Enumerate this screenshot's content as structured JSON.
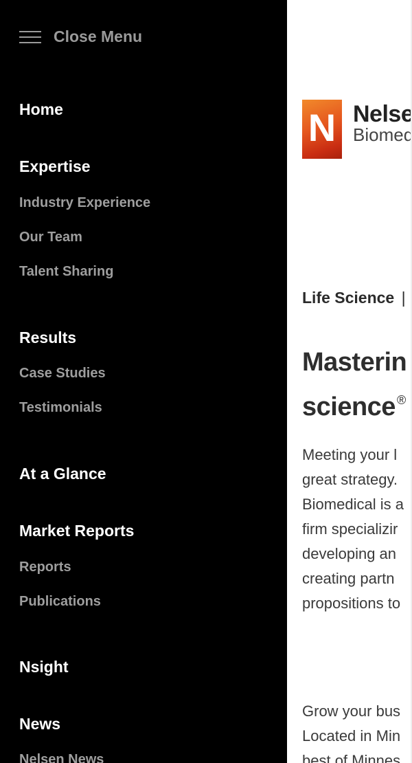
{
  "menu": {
    "close_label": "Close Menu",
    "items": [
      {
        "label": "Home",
        "level": "main"
      },
      {
        "label": "Expertise",
        "level": "main"
      },
      {
        "label": "Industry Experience",
        "level": "sub"
      },
      {
        "label": "Our Team",
        "level": "sub"
      },
      {
        "label": "Talent Sharing",
        "level": "sub"
      },
      {
        "label": "Results",
        "level": "main"
      },
      {
        "label": "Case Studies",
        "level": "sub"
      },
      {
        "label": "Testimonials",
        "level": "sub"
      },
      {
        "label": "At a Glance",
        "level": "main"
      },
      {
        "label": "Market Reports",
        "level": "main"
      },
      {
        "label": "Reports",
        "level": "sub"
      },
      {
        "label": "Publications",
        "level": "sub"
      },
      {
        "label": "Nsight",
        "level": "main"
      },
      {
        "label": "News",
        "level": "main"
      },
      {
        "label": "Nelsen News",
        "level": "sub"
      }
    ]
  },
  "page": {
    "logo": {
      "mark_letter": "N",
      "name": "Nelse",
      "subtitle": "Biomed"
    },
    "breadcrumb": {
      "label": "Life Science",
      "separator": "|"
    },
    "headline": {
      "line1": "Masterin",
      "line2": "science",
      "mark": "®"
    },
    "paragraph1": [
      "Meeting your l",
      "great strategy.",
      "Biomedical is a",
      "firm specializir",
      "developing an",
      "creating partn",
      "propositions to"
    ],
    "paragraph2": [
      "Grow your bus",
      "Located in Min",
      "best of Minnes"
    ]
  },
  "colors": {
    "menu_background": "#000000",
    "menu_main_text": "#ffffff",
    "menu_sub_text": "#9e9e9e",
    "logo_orange": "#e5571f"
  }
}
